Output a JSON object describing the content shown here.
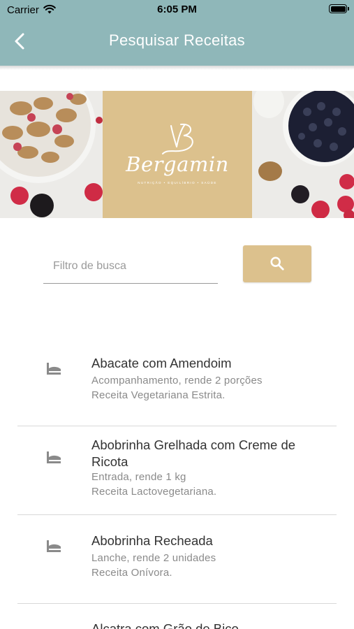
{
  "status_bar": {
    "carrier": "Carrier",
    "time": "6:05 PM"
  },
  "header": {
    "title": "Pesquisar Receitas",
    "back_icon": "chevron-left-icon",
    "background_color": "#8fb7b9"
  },
  "banner": {
    "brand_name": "Bergamin",
    "brand_tagline": "NUTRIÇÃO • EQUILÍBRIO • SAÚDE",
    "logo_color": "#dcc18d"
  },
  "search": {
    "placeholder": "Filtro de busca",
    "value": "",
    "button_icon": "search-icon",
    "button_color": "#dcc18d"
  },
  "recipes": [
    {
      "name": "Abacate com Amendoim",
      "info": "Acompanhamento, rende 2 porções",
      "diet": "Receita Vegetariana Estrita.",
      "icon": "cooking-scale-icon"
    },
    {
      "name": "Abobrinha Grelhada com Creme de Ricota",
      "info": "Entrada, rende 1 kg",
      "diet": "Receita Lactovegetariana.",
      "icon": "cooking-scale-icon"
    },
    {
      "name": "Abobrinha Recheada",
      "info": "Lanche, rende 2 unidades",
      "diet": "Receita Onívora.",
      "icon": "cooking-scale-icon"
    },
    {
      "name": "Alcatra com Grão de Bico",
      "info": "",
      "diet": "",
      "icon": "cooking-scale-icon"
    }
  ]
}
